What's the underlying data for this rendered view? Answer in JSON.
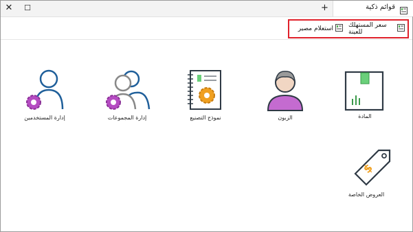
{
  "window": {
    "close_glyph": "✕",
    "maximize_glyph": "☐"
  },
  "tabs": [
    {
      "label": "قوائم ذكية"
    }
  ],
  "new_tab_glyph": "+",
  "toolbar": {
    "buttons": [
      {
        "label": "سعر المستهلك للعينة"
      },
      {
        "label": "استعلام مصير"
      }
    ]
  },
  "tiles": [
    {
      "label": "المادة"
    },
    {
      "label": "الزبون"
    },
    {
      "label": "نموذج التصنيع"
    },
    {
      "label": "إدارة المجموعات"
    },
    {
      "label": "إدارة المستخدمين"
    },
    {
      "label": "العروض الخاصة"
    }
  ],
  "colors": {
    "highlight": "#e0202a",
    "green": "#4caf50",
    "purple": "#b54cc2",
    "orange": "#f0a020",
    "blue": "#1f5f9a",
    "dark": "#2f3a45"
  }
}
